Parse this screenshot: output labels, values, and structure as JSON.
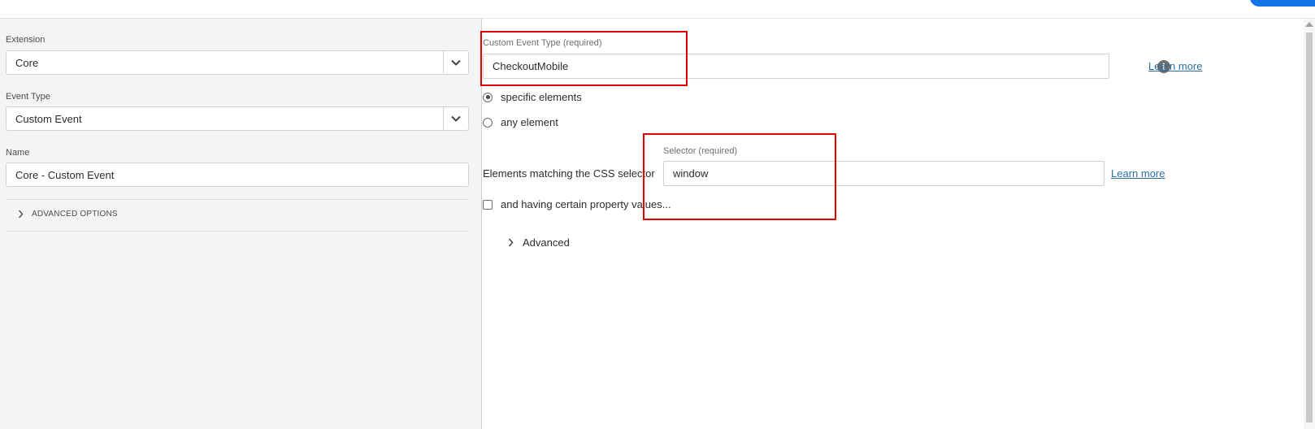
{
  "left_panel": {
    "extension": {
      "label": "Extension",
      "value": "Core"
    },
    "event_type": {
      "label": "Event Type",
      "value": "Custom Event"
    },
    "name": {
      "label": "Name",
      "value": "Core - Custom Event"
    },
    "advanced_options_label": "ADVANCED OPTIONS"
  },
  "right_panel": {
    "custom_event_type": {
      "label": "Custom Event Type (required)",
      "value": "CheckoutMobile"
    },
    "learn_more_1": "Learn more",
    "radio_specific": "specific elements",
    "radio_any": "any element",
    "selector": {
      "prefix": "Elements matching the CSS selector",
      "label": "Selector (required)",
      "value": "window"
    },
    "learn_more_2": "Learn more",
    "property_values_checkbox": "and having certain property values...",
    "advanced_label": "Advanced"
  },
  "icons": {
    "info": "info-icon",
    "chevron_down": "chevron-down-icon",
    "chevron_right": "chevron-right-icon"
  },
  "colors": {
    "link": "#2f6ea1",
    "highlight_box": "#e00000",
    "primary_button": "#1473e6"
  }
}
